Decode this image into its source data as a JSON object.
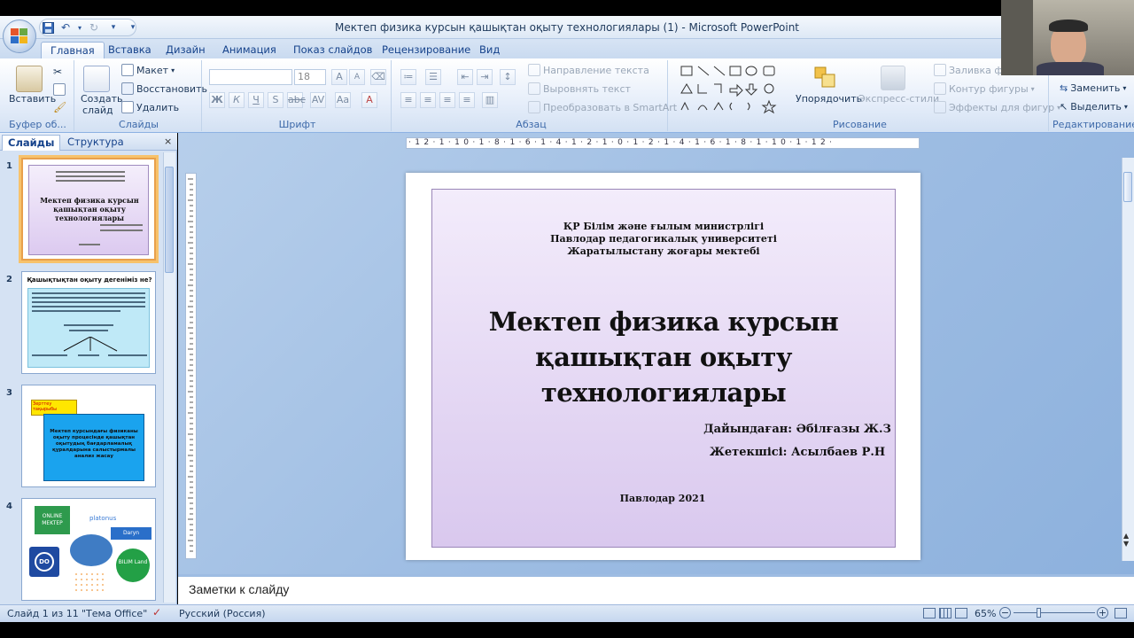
{
  "window": {
    "title": "Мектеп физика курсын қашықтан оқыту технологиялары (1) - Microsoft PowerPoint"
  },
  "tabs": [
    "Главная",
    "Вставка",
    "Дизайн",
    "Анимация",
    "Показ слайдов",
    "Рецензирование",
    "Вид"
  ],
  "ribbon": {
    "clipboard": {
      "label": "Буфер об...",
      "paste": "Вставить"
    },
    "slides": {
      "label": "Слайды",
      "new_slide_1": "Создать",
      "new_slide_2": "слайд",
      "layout": "Макет",
      "reset": "Восстановить",
      "delete": "Удалить"
    },
    "font": {
      "label": "Шрифт",
      "size": "18"
    },
    "paragraph": {
      "label": "Абзац",
      "text_direction": "Направление текста",
      "align_text": "Выровнять текст",
      "smartart": "Преобразовать в SmartArt"
    },
    "drawing": {
      "label": "Рисование",
      "arrange": "Упорядочить",
      "quick_styles": "Экспресс-стили",
      "shape_fill": "Заливка фи",
      "shape_outline": "Контур фигуры",
      "shape_effects": "Эффекты для фигур"
    },
    "editing": {
      "label": "Редактирование",
      "replace": "Заменить",
      "select": "Выделить"
    }
  },
  "pane": {
    "tab_slides": "Слайды",
    "tab_outline": "Структура",
    "close": "×"
  },
  "thumbnails": [
    {
      "num": "1"
    },
    {
      "num": "2"
    },
    {
      "num": "3"
    },
    {
      "num": "4"
    }
  ],
  "thumb2": {
    "title": "Қашықтықтан оқыту дегеніміз не?"
  },
  "thumb3": {
    "tag": "Зерттеу тақырыбы",
    "box": "Мектеп курсындағы физиканы оқыту процесінде қашықтан оқытудың бағдарламалық құралдарына салыстырмалы анализ жасау"
  },
  "thumb4": {
    "online": "ONLINE MEKTEP",
    "platonus": "platonus",
    "daryn": "Daryn",
    "do": "DO",
    "bilim": "BILIM Land"
  },
  "slide": {
    "header1": "ҚР Білім және ғылым министрлігі",
    "header2": "Павлодар педагогикалық университеті",
    "header3": "Жаратылыстану жоғары мектебі",
    "title1": "Мектеп физика курсын",
    "title2": "қашықтан оқыту технологиялары",
    "author": "Дайындаған: Әбілғазы Ж.З",
    "supervisor": "Жетекшісі: Асылбаев Р.Н",
    "city": "Павлодар  2021"
  },
  "ruler_h": "·12·1·10·1·8·1·6·1·4·1·2·1·0·1·2·1·4·1·6·1·8·1·10·1·12·",
  "notes": {
    "placeholder": "Заметки к слайду"
  },
  "status": {
    "slide": "Слайд 1 из 11",
    "theme": "\"Тема Office\"",
    "language": "Русский (Россия)",
    "zoom": "65%"
  },
  "colors": {
    "ribbon_blue": "#15428b",
    "slide_bg": "#e6dcf3",
    "workspace": "#9ebde3",
    "selection": "#e8a04c"
  }
}
